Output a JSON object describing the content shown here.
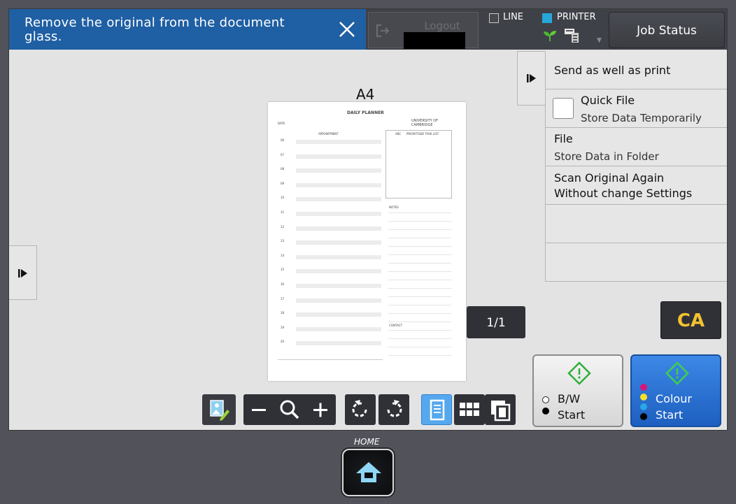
{
  "message": {
    "text": "Remove the original from the document glass."
  },
  "header": {
    "logout_label": "Logout",
    "line_label": "LINE",
    "printer_label": "PRINTER",
    "job_status_label": "Job Status"
  },
  "right_panel": {
    "items": [
      {
        "title": "Send as well as print",
        "sub": ""
      },
      {
        "title": "Quick File",
        "sub": "Store Data Temporarily"
      },
      {
        "title": "File",
        "sub": "Store Data in Folder"
      },
      {
        "title": "Scan Original Again",
        "sub": "Without change Settings"
      }
    ]
  },
  "preview": {
    "paper_size": "A4",
    "page_counter": "1/1",
    "doc": {
      "title": "DAILY PLANNER",
      "date_label": "DATE",
      "org": "UNIVERSITY OF CAMBRIDGE",
      "col_appointment": "APPOINTMENT",
      "col_tasks": "PRIORITISED TASK LIST",
      "col_abc": "ABC",
      "notes": "NOTES",
      "contact": "CONTACT",
      "hours": [
        "06",
        "07",
        "08",
        "09",
        "10",
        "11",
        "12",
        "13",
        "14",
        "15",
        "16",
        "17",
        "18",
        "19",
        "20"
      ]
    }
  },
  "buttons": {
    "ca": "CA",
    "bw_line1": "B/W",
    "bw_line2": "Start",
    "colour_line1": "Colour",
    "colour_line2": "Start"
  },
  "home": {
    "label": "HOME"
  },
  "colors": {
    "message_bg": "#1f5fa3",
    "ca_text": "#f2c230",
    "colour_start_bg": "#2a72d6",
    "printer_indicator": "#27a7d9"
  }
}
